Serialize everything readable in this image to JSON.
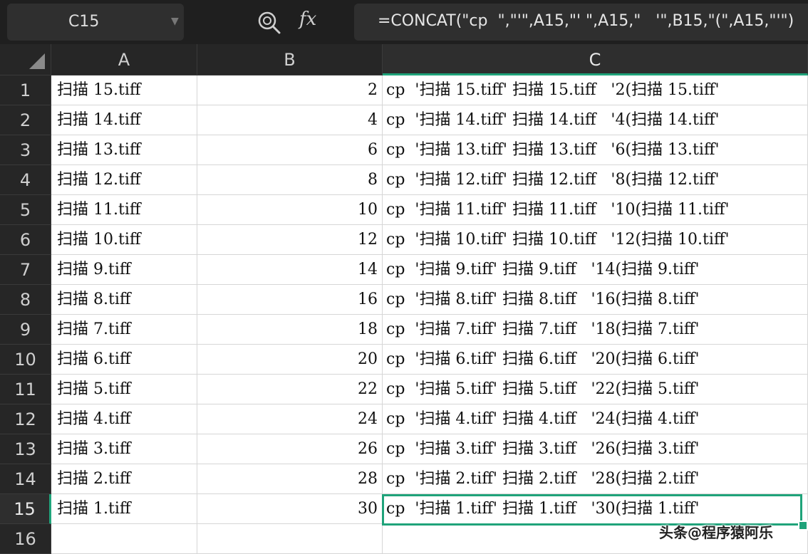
{
  "name_box": {
    "value": "C15"
  },
  "formula_bar": {
    "fx_label": "fx",
    "value": "=CONCAT(\"cp  \",\"'\",A15,\"' \",A15,\"   '\",B15,\"(\",A15,\"'\")"
  },
  "columns": [
    "A",
    "B",
    "C"
  ],
  "rows": [
    {
      "num": "1",
      "a": "扫描 15.tiff",
      "b": "2",
      "c": "cp  '扫描 15.tiff' 扫描 15.tiff   '2(扫描 15.tiff'"
    },
    {
      "num": "2",
      "a": "扫描 14.tiff",
      "b": "4",
      "c": "cp  '扫描 14.tiff' 扫描 14.tiff   '4(扫描 14.tiff'"
    },
    {
      "num": "3",
      "a": "扫描 13.tiff",
      "b": "6",
      "c": "cp  '扫描 13.tiff' 扫描 13.tiff   '6(扫描 13.tiff'"
    },
    {
      "num": "4",
      "a": "扫描 12.tiff",
      "b": "8",
      "c": "cp  '扫描 12.tiff' 扫描 12.tiff   '8(扫描 12.tiff'"
    },
    {
      "num": "5",
      "a": "扫描 11.tiff",
      "b": "10",
      "c": "cp  '扫描 11.tiff' 扫描 11.tiff   '10(扫描 11.tiff'"
    },
    {
      "num": "6",
      "a": "扫描 10.tiff",
      "b": "12",
      "c": "cp  '扫描 10.tiff' 扫描 10.tiff   '12(扫描 10.tiff'"
    },
    {
      "num": "7",
      "a": "扫描 9.tiff",
      "b": "14",
      "c": "cp  '扫描 9.tiff' 扫描 9.tiff   '14(扫描 9.tiff'"
    },
    {
      "num": "8",
      "a": "扫描 8.tiff",
      "b": "16",
      "c": "cp  '扫描 8.tiff' 扫描 8.tiff   '16(扫描 8.tiff'"
    },
    {
      "num": "9",
      "a": "扫描 7.tiff",
      "b": "18",
      "c": "cp  '扫描 7.tiff' 扫描 7.tiff   '18(扫描 7.tiff'"
    },
    {
      "num": "10",
      "a": "扫描 6.tiff",
      "b": "20",
      "c": "cp  '扫描 6.tiff' 扫描 6.tiff   '20(扫描 6.tiff'"
    },
    {
      "num": "11",
      "a": "扫描 5.tiff",
      "b": "22",
      "c": "cp  '扫描 5.tiff' 扫描 5.tiff   '22(扫描 5.tiff'"
    },
    {
      "num": "12",
      "a": "扫描 4.tiff",
      "b": "24",
      "c": "cp  '扫描 4.tiff' 扫描 4.tiff   '24(扫描 4.tiff'"
    },
    {
      "num": "13",
      "a": "扫描 3.tiff",
      "b": "26",
      "c": "cp  '扫描 3.tiff' 扫描 3.tiff   '26(扫描 3.tiff'"
    },
    {
      "num": "14",
      "a": "扫描 2.tiff",
      "b": "28",
      "c": "cp  '扫描 2.tiff' 扫描 2.tiff   '28(扫描 2.tiff'"
    },
    {
      "num": "15",
      "a": "扫描 1.tiff",
      "b": "30",
      "c": "cp  '扫描 1.tiff' 扫描 1.tiff   '30(扫描 1.tiff'"
    },
    {
      "num": "16",
      "a": "",
      "b": "",
      "c": ""
    }
  ],
  "active_cell": {
    "column": "C",
    "row": "15"
  },
  "watermark": "头条@程序猿阿乐",
  "colors": {
    "accent": "#1fa37a",
    "background": "#1f1f1f",
    "header": "#262626",
    "cell": "#ffffff"
  },
  "icons": {
    "zoom": "zoom-icon",
    "fx": "fx-icon",
    "dropdown": "chevron-down-icon",
    "select_all": "select-all-triangle-icon"
  }
}
